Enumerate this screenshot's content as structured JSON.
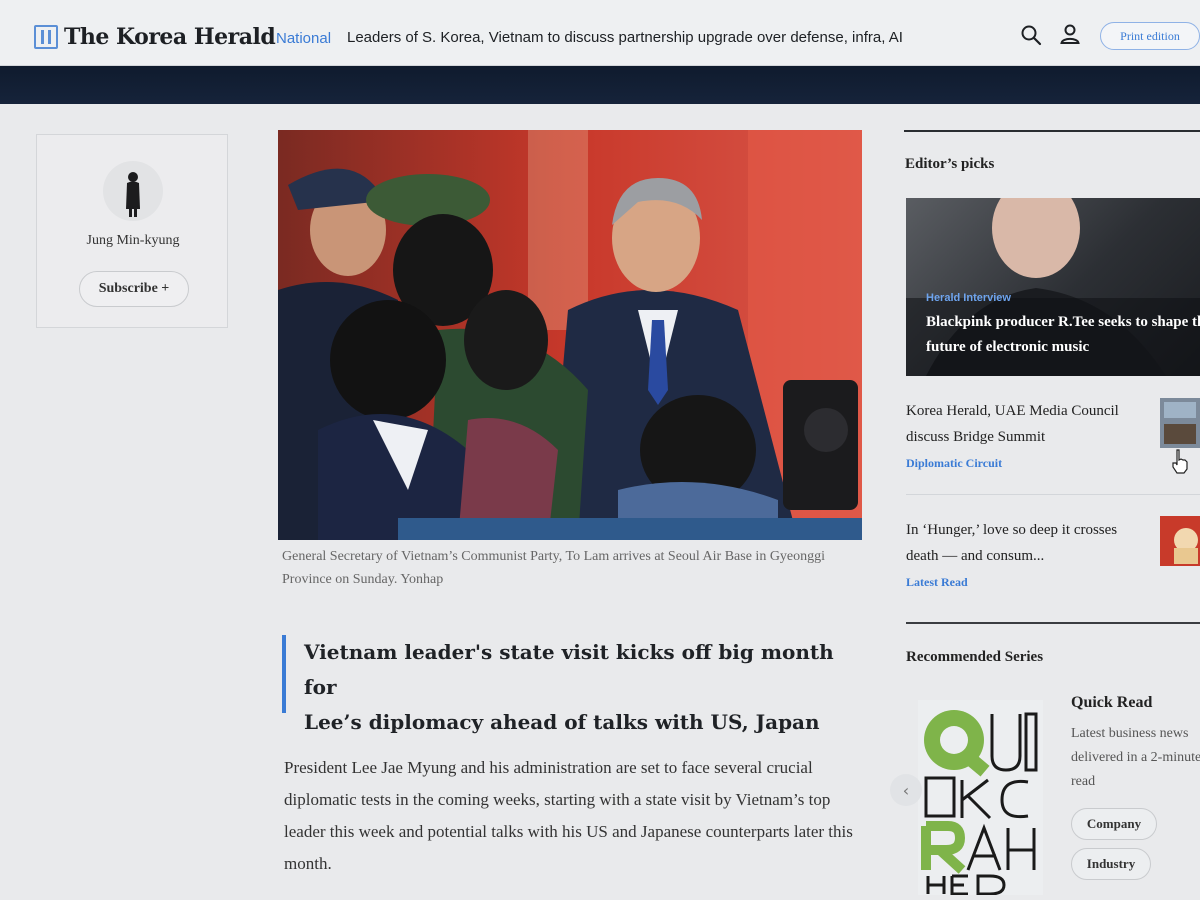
{
  "header": {
    "logo_text": "The Korea Herald",
    "section": "National",
    "headline": "Leaders of S. Korea, Vietnam to discuss partnership upgrade over defense, infra, AI",
    "print_label": "Print edition"
  },
  "author": {
    "name": "Jung Min-kyung",
    "subscribe_label": "Subscribe +"
  },
  "article": {
    "caption": "General Secretary of Vietnam’s Communist Party, To Lam arrives at Seoul Air Base in Gyeonggi Province on Sunday. Yonhap",
    "headline_line1": "Vietnam leader's state visit kicks off big month for",
    "headline_line2": "Lee’s diplomacy ahead of talks with US, Japan",
    "body": "President Lee Jae Myung and his administration are set to face several crucial diplomatic tests in the coming weeks, starting with a state visit by Vietnam’s top leader this week and potential talks with his US and Japanese counterparts later this month."
  },
  "editors_picks": {
    "title": "Editor’s picks",
    "hero": {
      "tag": "Herald Interview",
      "title": "Blackpink producer R.Tee seeks to shape the future of electronic music"
    },
    "items": [
      {
        "title": "Korea Herald, UAE Media Council discuss Bridge Summit",
        "tag": "Diplomatic Circuit"
      },
      {
        "title": "In ‘Hunger,’ love so deep it crosses death — and consum...",
        "tag": "Latest Read"
      }
    ]
  },
  "recommended": {
    "title": "Recommended Series",
    "series_name": "Quick Read",
    "series_desc": "Latest business news delivered in a 2-minute read",
    "chips": [
      "Company",
      "Industry"
    ],
    "prev_label": "‹"
  },
  "colors": {
    "accent": "#3a7bd5",
    "header_band": "#0f1b2e"
  }
}
